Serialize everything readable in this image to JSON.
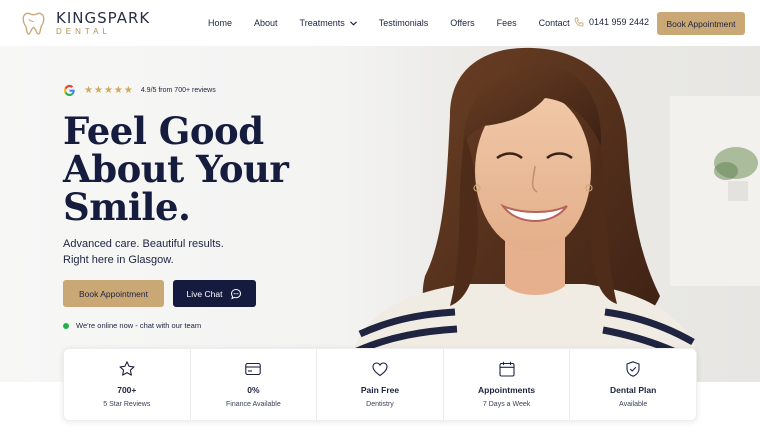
{
  "brand": {
    "name": "KINGSPARK",
    "sub": "DENTAL",
    "logo_icon": "tooth-icon",
    "accent": "#c9a876",
    "navy": "#141b3f"
  },
  "nav": {
    "items": [
      {
        "label": "Home"
      },
      {
        "label": "About"
      },
      {
        "label": "Treatments"
      },
      {
        "label": "Testimonials"
      },
      {
        "label": "Offers"
      },
      {
        "label": "Fees"
      },
      {
        "label": "Contact"
      }
    ],
    "phone": "0141 959 2442",
    "cta": "Book Appointment"
  },
  "hero": {
    "rating": {
      "stars": 5,
      "text": "4.9/5 from 700+ reviews"
    },
    "headline": [
      "Feel Good",
      "About Your",
      "Smile."
    ],
    "subtext": [
      "Advanced care. Beautiful results.",
      "Right here in Glasgow."
    ],
    "primary_button": "Book Appointment",
    "chat_button": "Live Chat",
    "online_status": "We're online now - chat with our team",
    "online_color": "#27b04c"
  },
  "stats": [
    {
      "icon": "star-icon",
      "title": "700+",
      "subtitle": "5 Star Reviews"
    },
    {
      "icon": "card-icon",
      "title": "0%",
      "subtitle": "Finance Available"
    },
    {
      "icon": "heart-icon",
      "title": "Pain Free",
      "subtitle": "Dentistry"
    },
    {
      "icon": "calendar-icon",
      "title": "Appointments",
      "subtitle": "7 Days a Week"
    },
    {
      "icon": "shield-check-icon",
      "title": "Dental Plan",
      "subtitle": "Available"
    }
  ]
}
